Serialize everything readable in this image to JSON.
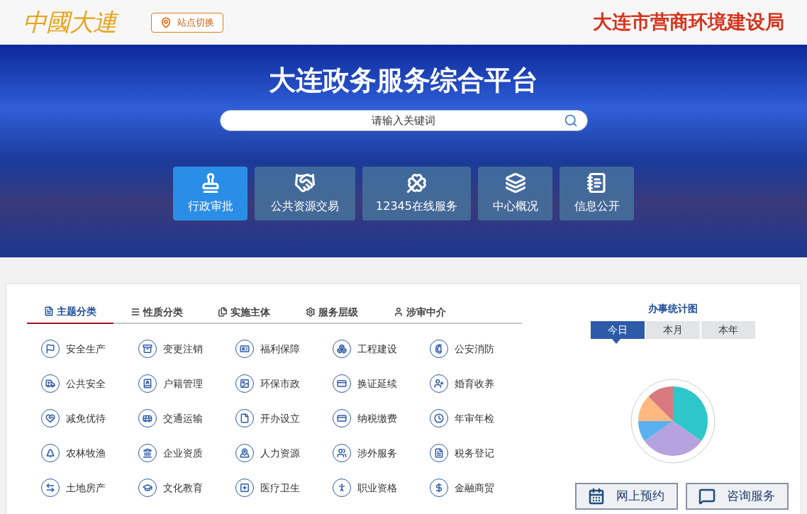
{
  "header": {
    "logo": "中國大連",
    "site_switch": "站点切换",
    "agency": "大连市营商环境建设局"
  },
  "banner": {
    "title": "大连政务服务综合平台",
    "search": {
      "placeholder": "请输入关键词"
    },
    "tiles": [
      {
        "label": "行政审批",
        "selected": true
      },
      {
        "label": "公共资源交易",
        "selected": false
      },
      {
        "label": "12345在线服务",
        "selected": false
      },
      {
        "label": "中心概况",
        "selected": false
      },
      {
        "label": "信息公开",
        "selected": false
      }
    ]
  },
  "category_tabs": [
    {
      "label": "主题分类",
      "selected": true
    },
    {
      "label": "性质分类",
      "selected": false
    },
    {
      "label": "实施主体",
      "selected": false
    },
    {
      "label": "服务层级",
      "selected": false
    },
    {
      "label": "涉审中介",
      "selected": false
    }
  ],
  "categories": [
    "安全生产",
    "变更注销",
    "福利保障",
    "工程建设",
    "公安消防",
    "公共安全",
    "户籍管理",
    "环保市政",
    "换证延续",
    "婚育收养",
    "减免优待",
    "交通运输",
    "开办设立",
    "纳税缴费",
    "年审年检",
    "农林牧渔",
    "企业资质",
    "人力资源",
    "涉外服务",
    "税务登记",
    "土地房产",
    "文化教育",
    "医疗卫生",
    "职业资格",
    "金融商贸"
  ],
  "stats": {
    "title": "办事统计图",
    "periods": [
      {
        "label": "今日",
        "selected": true
      },
      {
        "label": "本月",
        "selected": false
      },
      {
        "label": "本年",
        "selected": false
      }
    ]
  },
  "actions": [
    "网上预约",
    "咨询服务"
  ]
}
